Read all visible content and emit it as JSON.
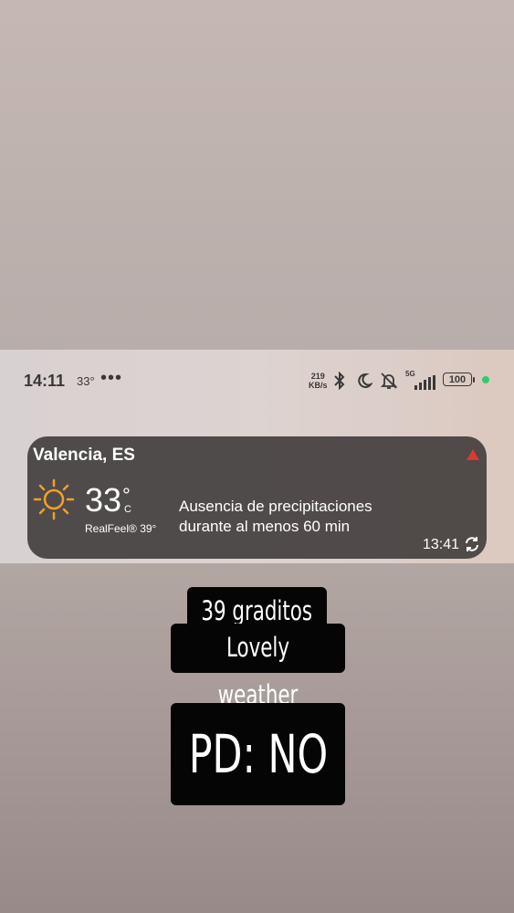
{
  "status_bar": {
    "time": "14:11",
    "temperature": "33°",
    "more": "•••",
    "speed_value": "219",
    "speed_unit": "KB/s",
    "network": "5G",
    "battery": "100",
    "icons": [
      "bluetooth-icon",
      "moon-icon",
      "bell-off-icon",
      "signal-icon",
      "battery-icon"
    ]
  },
  "weather_widget": {
    "city": "Valencia, ES",
    "temperature": "33",
    "degree": "°",
    "unit": "C",
    "realfeel": "RealFeel® 39°",
    "precip_line1": "Ausencia de precipitaciones",
    "precip_line2": "durante al menos 60 min",
    "updated_time": "13:41",
    "icons": [
      "sun-icon",
      "warning-icon",
      "refresh-icon"
    ],
    "colors": {
      "sun": "#f0a028",
      "warning": "#d93a32"
    }
  },
  "captions": {
    "line1": "39 graditos",
    "line2": "Lovely weather",
    "line3": "PD: NO"
  }
}
